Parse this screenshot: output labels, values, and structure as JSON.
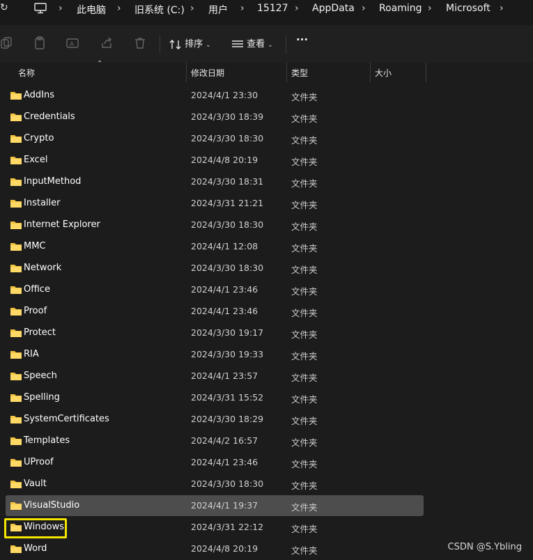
{
  "address_bar": {
    "breadcrumbs": [
      "此电脑",
      "旧系统 (C:)",
      "用户",
      "15127",
      "AppData",
      "Roaming",
      "Microsoft"
    ]
  },
  "toolbar": {
    "sort_label": "排序",
    "view_label": "查看",
    "more_label": "···"
  },
  "columns": {
    "name": "名称",
    "date": "修改日期",
    "type": "类型",
    "size": "大小"
  },
  "rows": [
    {
      "name": "AddIns",
      "date": "2024/4/1 23:30",
      "type": "文件夹"
    },
    {
      "name": "Credentials",
      "date": "2024/3/30 18:39",
      "type": "文件夹"
    },
    {
      "name": "Crypto",
      "date": "2024/3/30 18:30",
      "type": "文件夹"
    },
    {
      "name": "Excel",
      "date": "2024/4/8 20:19",
      "type": "文件夹"
    },
    {
      "name": "InputMethod",
      "date": "2024/3/30 18:31",
      "type": "文件夹"
    },
    {
      "name": "Installer",
      "date": "2024/3/31 21:21",
      "type": "文件夹"
    },
    {
      "name": "Internet Explorer",
      "date": "2024/3/30 18:30",
      "type": "文件夹"
    },
    {
      "name": "MMC",
      "date": "2024/4/1 12:08",
      "type": "文件夹"
    },
    {
      "name": "Network",
      "date": "2024/3/30 18:30",
      "type": "文件夹"
    },
    {
      "name": "Office",
      "date": "2024/4/1 23:46",
      "type": "文件夹"
    },
    {
      "name": "Proof",
      "date": "2024/4/1 23:46",
      "type": "文件夹"
    },
    {
      "name": "Protect",
      "date": "2024/3/30 19:17",
      "type": "文件夹"
    },
    {
      "name": "RIA",
      "date": "2024/3/30 19:33",
      "type": "文件夹"
    },
    {
      "name": "Speech",
      "date": "2024/4/1 23:57",
      "type": "文件夹"
    },
    {
      "name": "Spelling",
      "date": "2024/3/31 15:52",
      "type": "文件夹"
    },
    {
      "name": "SystemCertificates",
      "date": "2024/3/30 18:29",
      "type": "文件夹"
    },
    {
      "name": "Templates",
      "date": "2024/4/2 16:57",
      "type": "文件夹"
    },
    {
      "name": "UProof",
      "date": "2024/4/1 23:46",
      "type": "文件夹"
    },
    {
      "name": "Vault",
      "date": "2024/3/30 18:30",
      "type": "文件夹"
    },
    {
      "name": "VisualStudio",
      "date": "2024/4/1 19:37",
      "type": "文件夹"
    },
    {
      "name": "Windows",
      "date": "2024/3/31 22:12",
      "type": "文件夹"
    },
    {
      "name": "Word",
      "date": "2024/4/8 20:19",
      "type": "文件夹"
    }
  ],
  "selected_row": "VisualStudio",
  "highlighted_row": "Windows",
  "watermark": "CSDN @S.Ybling",
  "colors": {
    "background": "#1c1c1c",
    "selection": "#4d4d4d",
    "folder": "#f4c542",
    "highlight_box": "#f5e400"
  }
}
